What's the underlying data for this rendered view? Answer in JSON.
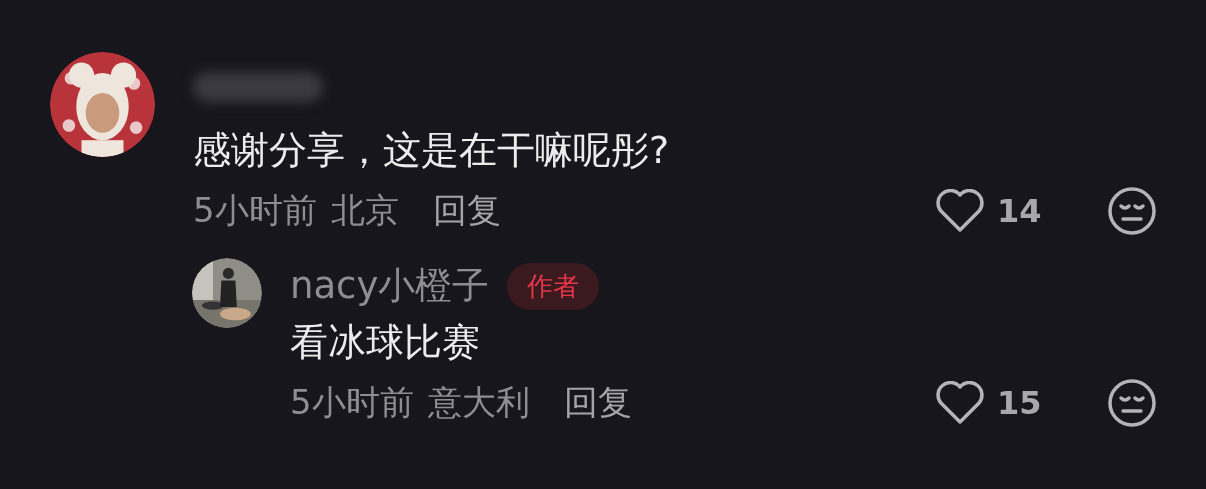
{
  "comments": [
    {
      "name_blurred": true,
      "text": "感谢分享，这是在干嘛呢彤?",
      "time": "5小时前",
      "location": "北京",
      "reply_label": "回复",
      "likes": "14",
      "replies": [
        {
          "name": "nacy小橙子",
          "badge": "作者",
          "text": "看冰球比赛",
          "time": "5小时前",
          "location": "意大利",
          "reply_label": "回复",
          "likes": "15"
        }
      ]
    }
  ]
}
